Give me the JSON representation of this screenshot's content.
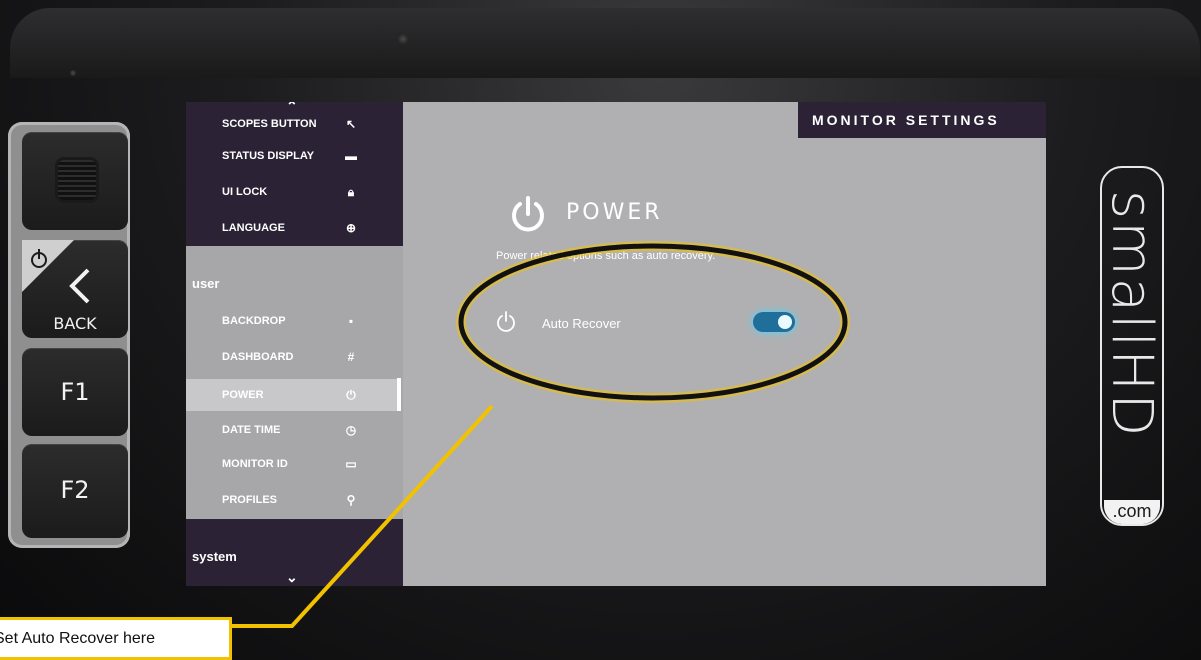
{
  "hardware": {
    "back_label": "BACK",
    "f1_label": "F1",
    "f2_label": "F2"
  },
  "sidebar": {
    "top_items": [
      {
        "label": "SCOPES BUTTON",
        "icon": "scopes-icon"
      },
      {
        "label": "STATUS DISPLAY",
        "icon": "status-display-icon"
      },
      {
        "label": "UI LOCK",
        "icon": "lock-icon"
      },
      {
        "label": "LANGUAGE",
        "icon": "globe-icon"
      }
    ],
    "user_section": "user",
    "user_items": [
      {
        "label": "BACKDROP",
        "icon": "backdrop-icon"
      },
      {
        "label": "DASHBOARD",
        "icon": "dashboard-icon"
      },
      {
        "label": "POWER",
        "icon": "power-icon",
        "active": true
      },
      {
        "label": "DATE TIME",
        "icon": "clock-icon"
      },
      {
        "label": "MONITOR ID",
        "icon": "monitor-id-icon"
      },
      {
        "label": "PROFILES",
        "icon": "profiles-icon"
      }
    ],
    "system_section": "system"
  },
  "header": {
    "title": "MONITOR SETTINGS"
  },
  "main": {
    "heading": "POWER",
    "description": "Power related options such as auto recovery.",
    "auto_recover_label": "Auto Recover",
    "auto_recover_enabled": true
  },
  "annotation": {
    "callout_text": "Set Auto Recover here",
    "highlight_color": "#f2c200"
  },
  "brand": {
    "name": "smallHD",
    "suffix": ".com"
  },
  "colors": {
    "panel_dark": "#2b2335",
    "screen_bg": "#b0b0b2",
    "toggle_on": "#1f6f9a"
  }
}
